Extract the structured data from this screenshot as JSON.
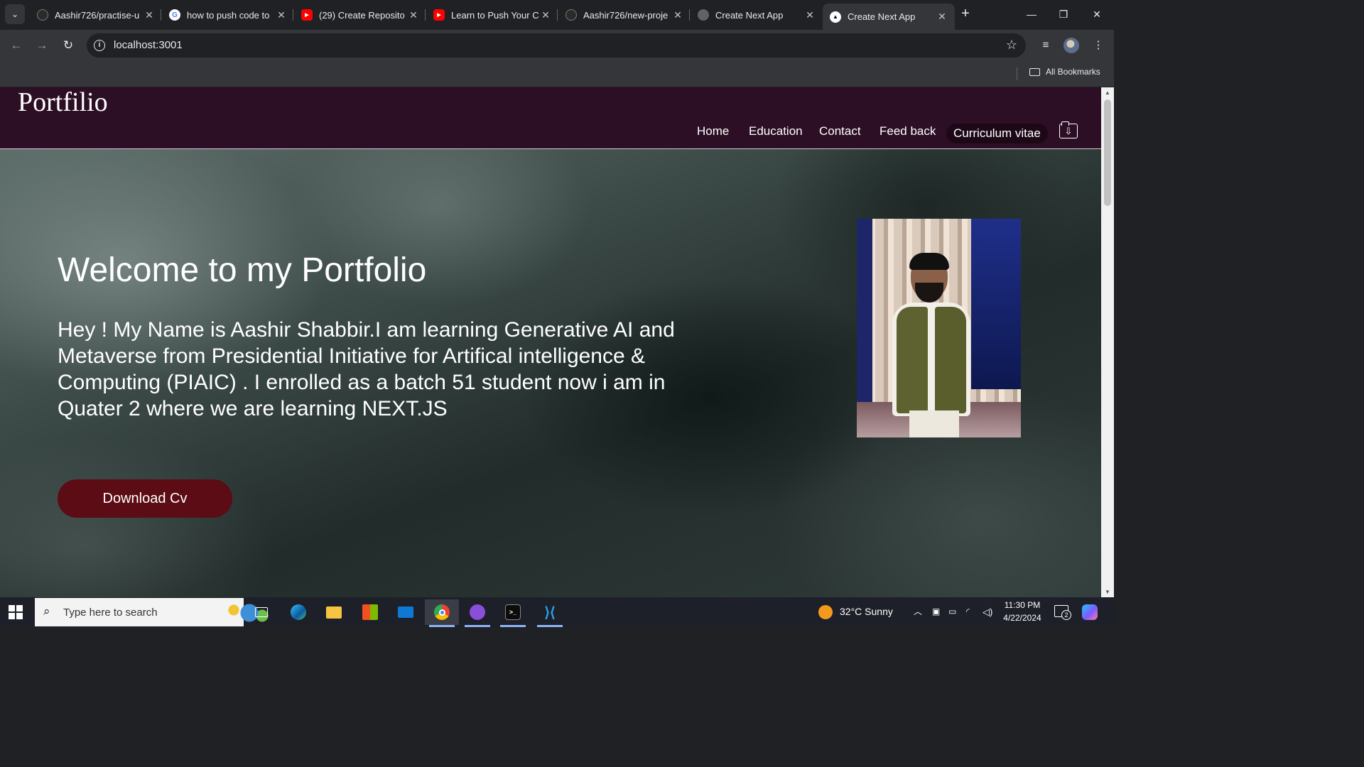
{
  "browser": {
    "tabs": [
      {
        "title": "Aashir726/practise-u",
        "favicon": "github-icon",
        "active": false
      },
      {
        "title": "how to push code to",
        "favicon": "google-icon",
        "active": false
      },
      {
        "title": "(29) Create Reposito",
        "favicon": "youtube-icon",
        "active": false
      },
      {
        "title": "Learn to Push Your C",
        "favicon": "youtube-icon",
        "active": false
      },
      {
        "title": "Aashir726/new-proje",
        "favicon": "github-icon",
        "active": false
      },
      {
        "title": "Create Next App",
        "favicon": "globe-icon",
        "active": false
      },
      {
        "title": "Create Next App",
        "favicon": "nextjs-icon",
        "active": true
      }
    ],
    "url": "localhost:3001",
    "bookmarks_label": "All Bookmarks"
  },
  "site": {
    "brand": "Portfilio",
    "nav": [
      "Home",
      "Education",
      "Contact",
      "Feed back"
    ],
    "cv_link": "Curriculum vitae",
    "hero": {
      "title": "Welcome to my Portfolio",
      "text": "Hey ! My Name is Aashir Shabbir.I am learning Generative AI and Metaverse from Presidential Initiative for Artifical intelligence & Computing (PIAIC) . I enrolled as a batch 51 student now i am in Quater 2 where we are learning NEXT.JS",
      "button": "Download Cv"
    }
  },
  "taskbar": {
    "search_placeholder": "Type here to search",
    "weather": "32°C  Sunny",
    "time": "11:30 PM",
    "date": "4/22/2024",
    "notification_count": "2"
  },
  "colors": {
    "header_bg": "#2c0f24",
    "button_bg": "#5b0c14",
    "chrome_dark": "#202124",
    "chrome_toolbar": "#35363a"
  }
}
